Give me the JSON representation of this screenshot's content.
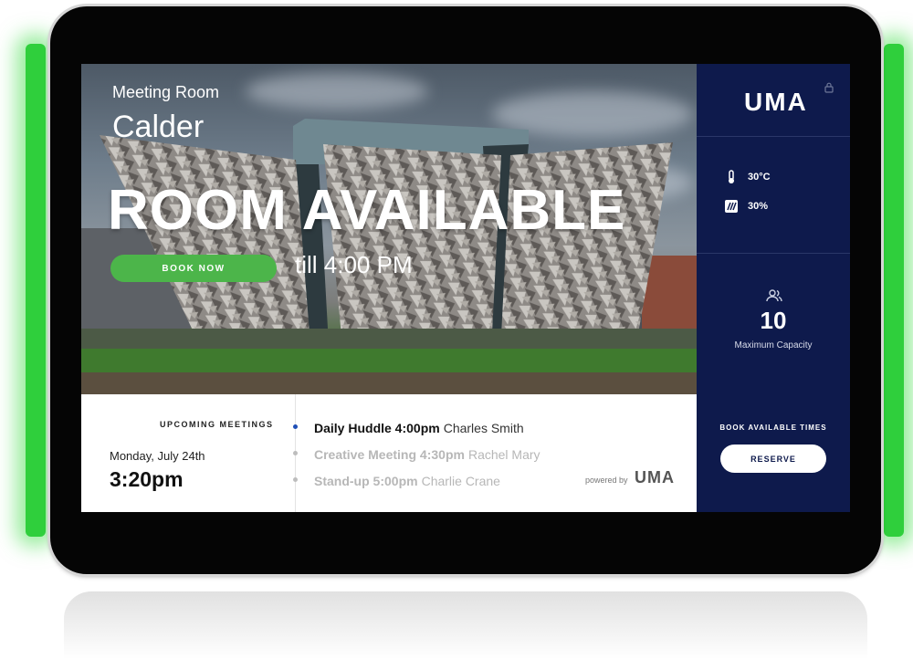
{
  "room": {
    "type_label": "Meeting Room",
    "name": "Calder",
    "status": "ROOM AVAILABLE",
    "book_now_label": "BOOK NOW",
    "available_until": "till 4:00 PM"
  },
  "sidebar": {
    "logo": "UMA",
    "lock_icon": "lock-icon",
    "temperature": {
      "icon": "thermometer-icon",
      "value": "30°C"
    },
    "humidity": {
      "icon": "humidity-icon",
      "value": "30%"
    },
    "capacity": {
      "icon": "people-icon",
      "value": "10",
      "label": "Maximum Capacity"
    },
    "book_times_label": "BOOK AVAILABLE TIMES",
    "reserve_label": "RESERVE"
  },
  "schedule": {
    "heading": "UPCOMING MEETINGS",
    "date": "Monday,  July 24th",
    "current_time": "3:20pm",
    "meetings": [
      {
        "title": "Daily Huddle 4:00pm",
        "host": "Charles Smith"
      },
      {
        "title": "Creative Meeting 4:30pm",
        "host": "Rachel Mary"
      },
      {
        "title": "Stand-up 5:00pm",
        "host": "Charlie Crane"
      }
    ],
    "powered_by": "powered by",
    "powered_logo": "UMA"
  },
  "colors": {
    "panel_navy": "#0e1a4c",
    "book_green": "#4cb54a",
    "led_green": "#2fcf3c",
    "active_dot": "#1f4fb6"
  }
}
